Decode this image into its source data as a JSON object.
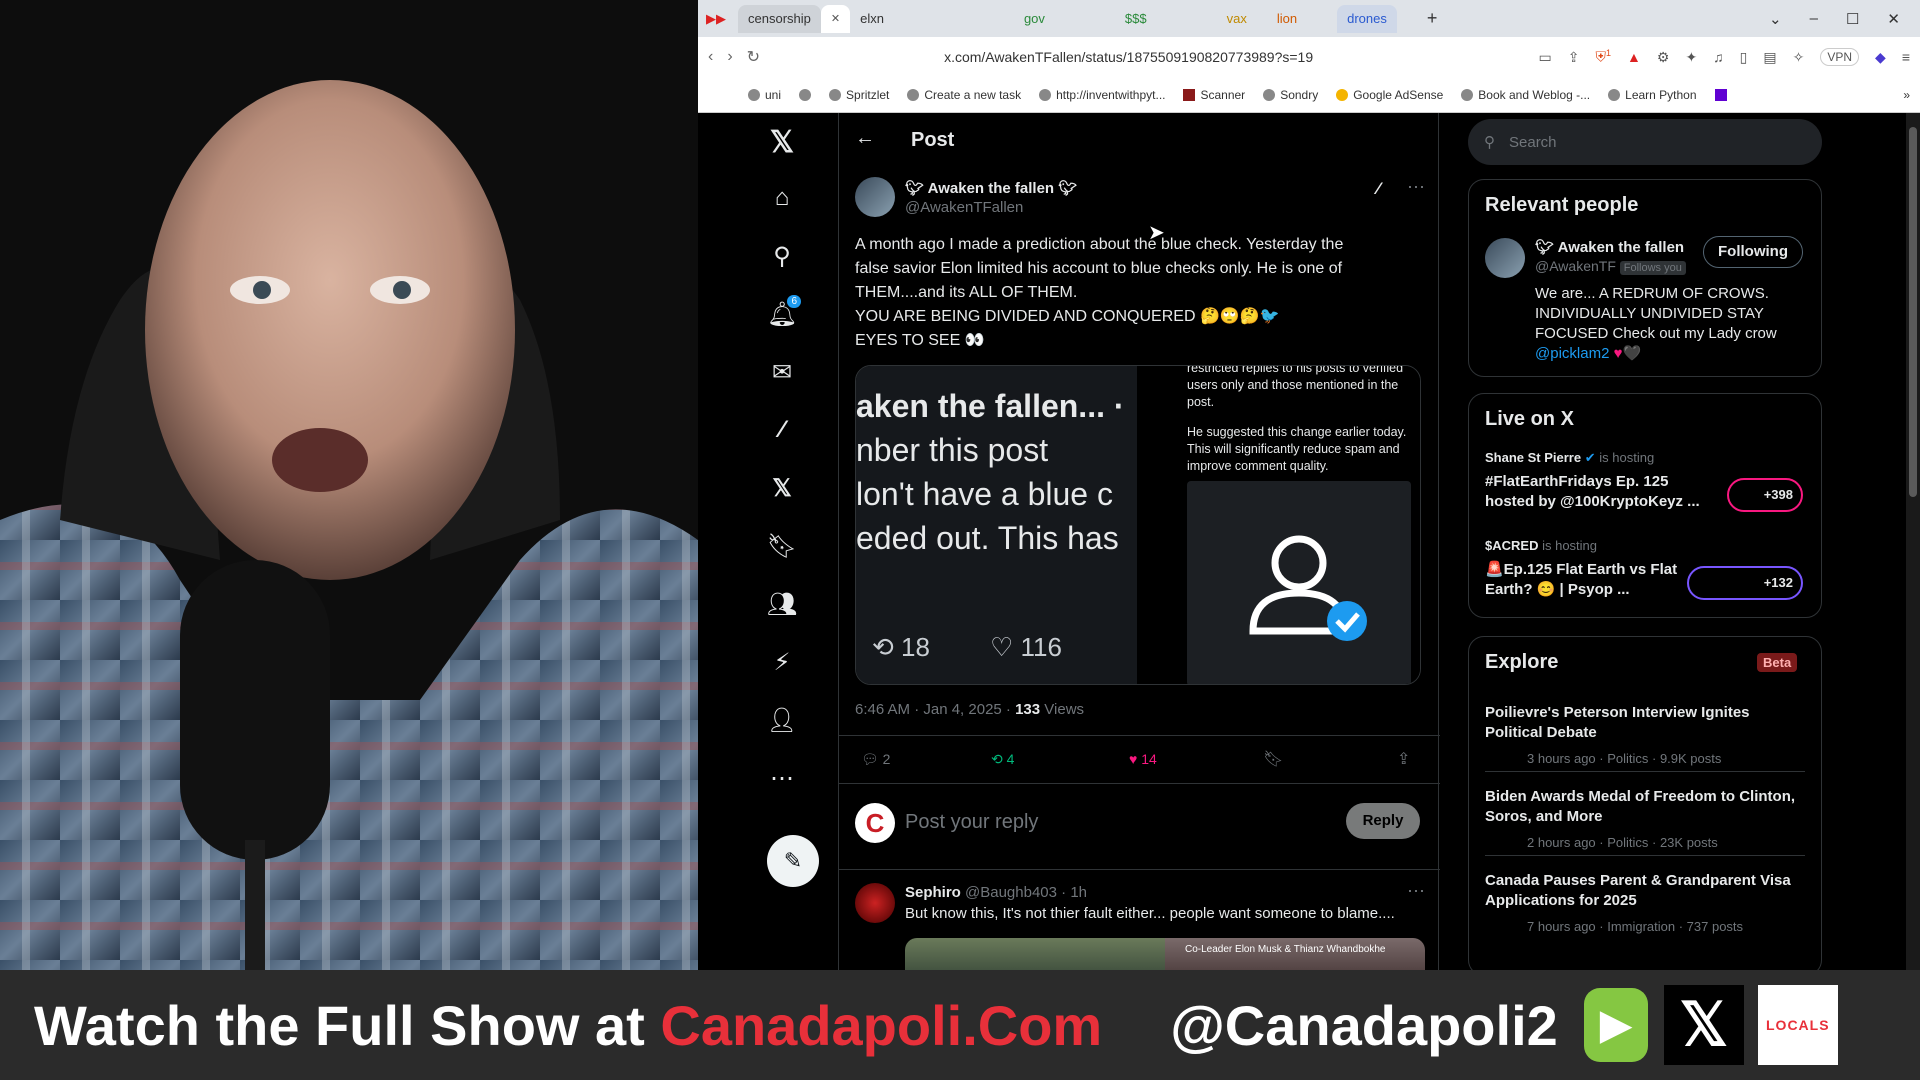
{
  "tabs": [
    "censorship",
    "elxn",
    "gov",
    "$$$",
    "vax",
    "lion",
    "drones"
  ],
  "window_controls": {
    "minimize": "–",
    "maximize": "☐",
    "close": "✕"
  },
  "address": {
    "url": "x.com/AwakenTFallen/status/1875509190820773989?s=19",
    "vpn_label": "VPN",
    "shield_badge": "1"
  },
  "bookmarks": [
    "uni",
    "Spritzlet",
    "Create a new task",
    "http://inventwithpyt...",
    "Scanner",
    "Sondry",
    "Google AdSense",
    "Book and Weblog -...",
    "Learn Python"
  ],
  "nav": {
    "notifications_badge": "6",
    "compose_icon": "feather-icon"
  },
  "post_header": {
    "title": "Post"
  },
  "tweet": {
    "display_name": "Awaken the fallen",
    "handle": "@AwakenTFallen",
    "text_lines": [
      "A month ago I made a prediction about the blue check. Yesterday the",
      "false savior Elon limited his account to blue checks only. He is one of",
      "THEM....and its ALL OF THEM.",
      "YOU ARE BEING DIVIDED AND CONQUERED 🤔🙄🤔🐦",
      "EYES TO SEE 👀"
    ],
    "media_left_lines": [
      "aken the fallen... ·",
      "nber this post",
      "lon't have a blue c",
      "eded out. This has"
    ],
    "media_left_retweets": "18",
    "media_left_likes": "116",
    "media_right_text_top": "restricted replies to his posts to verified users only and those mentioned in the post.",
    "media_right_text_bottom": "He suggested this change earlier today. This will significantly reduce spam and improve comment quality.",
    "timestamp": "6:46 AM · Jan 4, 2025 · ",
    "views_count": "133",
    "views_label": " Views",
    "replies": "2",
    "reposts": "4",
    "likes": "14"
  },
  "reply_box": {
    "placeholder": "Post your reply",
    "button": "Reply"
  },
  "reply": {
    "name": "Sephiro",
    "handle": "@Baughb403",
    "time": "· 1h",
    "text": "But know this, It's not thier fault either... people want someone to blame....",
    "media_caption": "Co-Leader Elon Musk & Thianz Whandbokhe"
  },
  "search": {
    "placeholder": "Search"
  },
  "relevant": {
    "title": "Relevant people",
    "name": "Awaken the fallen",
    "handle": "@AwakenTF",
    "follows_you": "Follows you",
    "button": "Following",
    "bio": "We are... A REDRUM OF CROWS. INDIVIDUALLY UNDIVIDED STAY FOCUSED Check out my Lady crow",
    "bio_link": "@picklam2"
  },
  "live": {
    "title": "Live on X",
    "items": [
      {
        "host": "Shane St Pierre",
        "status": "is hosting",
        "title1": "#FlatEarthFridays Ep. 125",
        "title2": "hosted by @100KryptoKeyz ...",
        "count": "+398"
      },
      {
        "host": "$ACRED",
        "status": "is hosting",
        "title1": "🚨Ep.125 Flat Earth vs Flat",
        "title2": "Earth? 😊 | Psyop ...",
        "count": "+132"
      }
    ]
  },
  "explore": {
    "title": "Explore",
    "beta": "Beta",
    "items": [
      {
        "title": "Poilievre's Peterson Interview Ignites Political Debate",
        "meta": "3 hours ago · Politics · 9.9K posts"
      },
      {
        "title": "Biden Awards Medal of Freedom to Clinton, Soros, and More",
        "meta": "2 hours ago · Politics · 23K posts"
      },
      {
        "title": "Canada Pauses Parent & Grandparent Visa Applications for 2025",
        "meta": "7 hours ago · Immigration · 737 posts"
      }
    ]
  },
  "banner": {
    "prefix": "Watch the Full Show at ",
    "site": "Canadapoli.Com",
    "handle": "@Canadapoli2",
    "logo_text": "LOCALS"
  },
  "colors": {
    "accent_blue": "#1d9bf0",
    "like_pink": "#f91880",
    "repost_green": "#00ba7c",
    "banner_red": "#e8303a",
    "live_pink": "#f91880",
    "live_purple": "#7856ff"
  }
}
